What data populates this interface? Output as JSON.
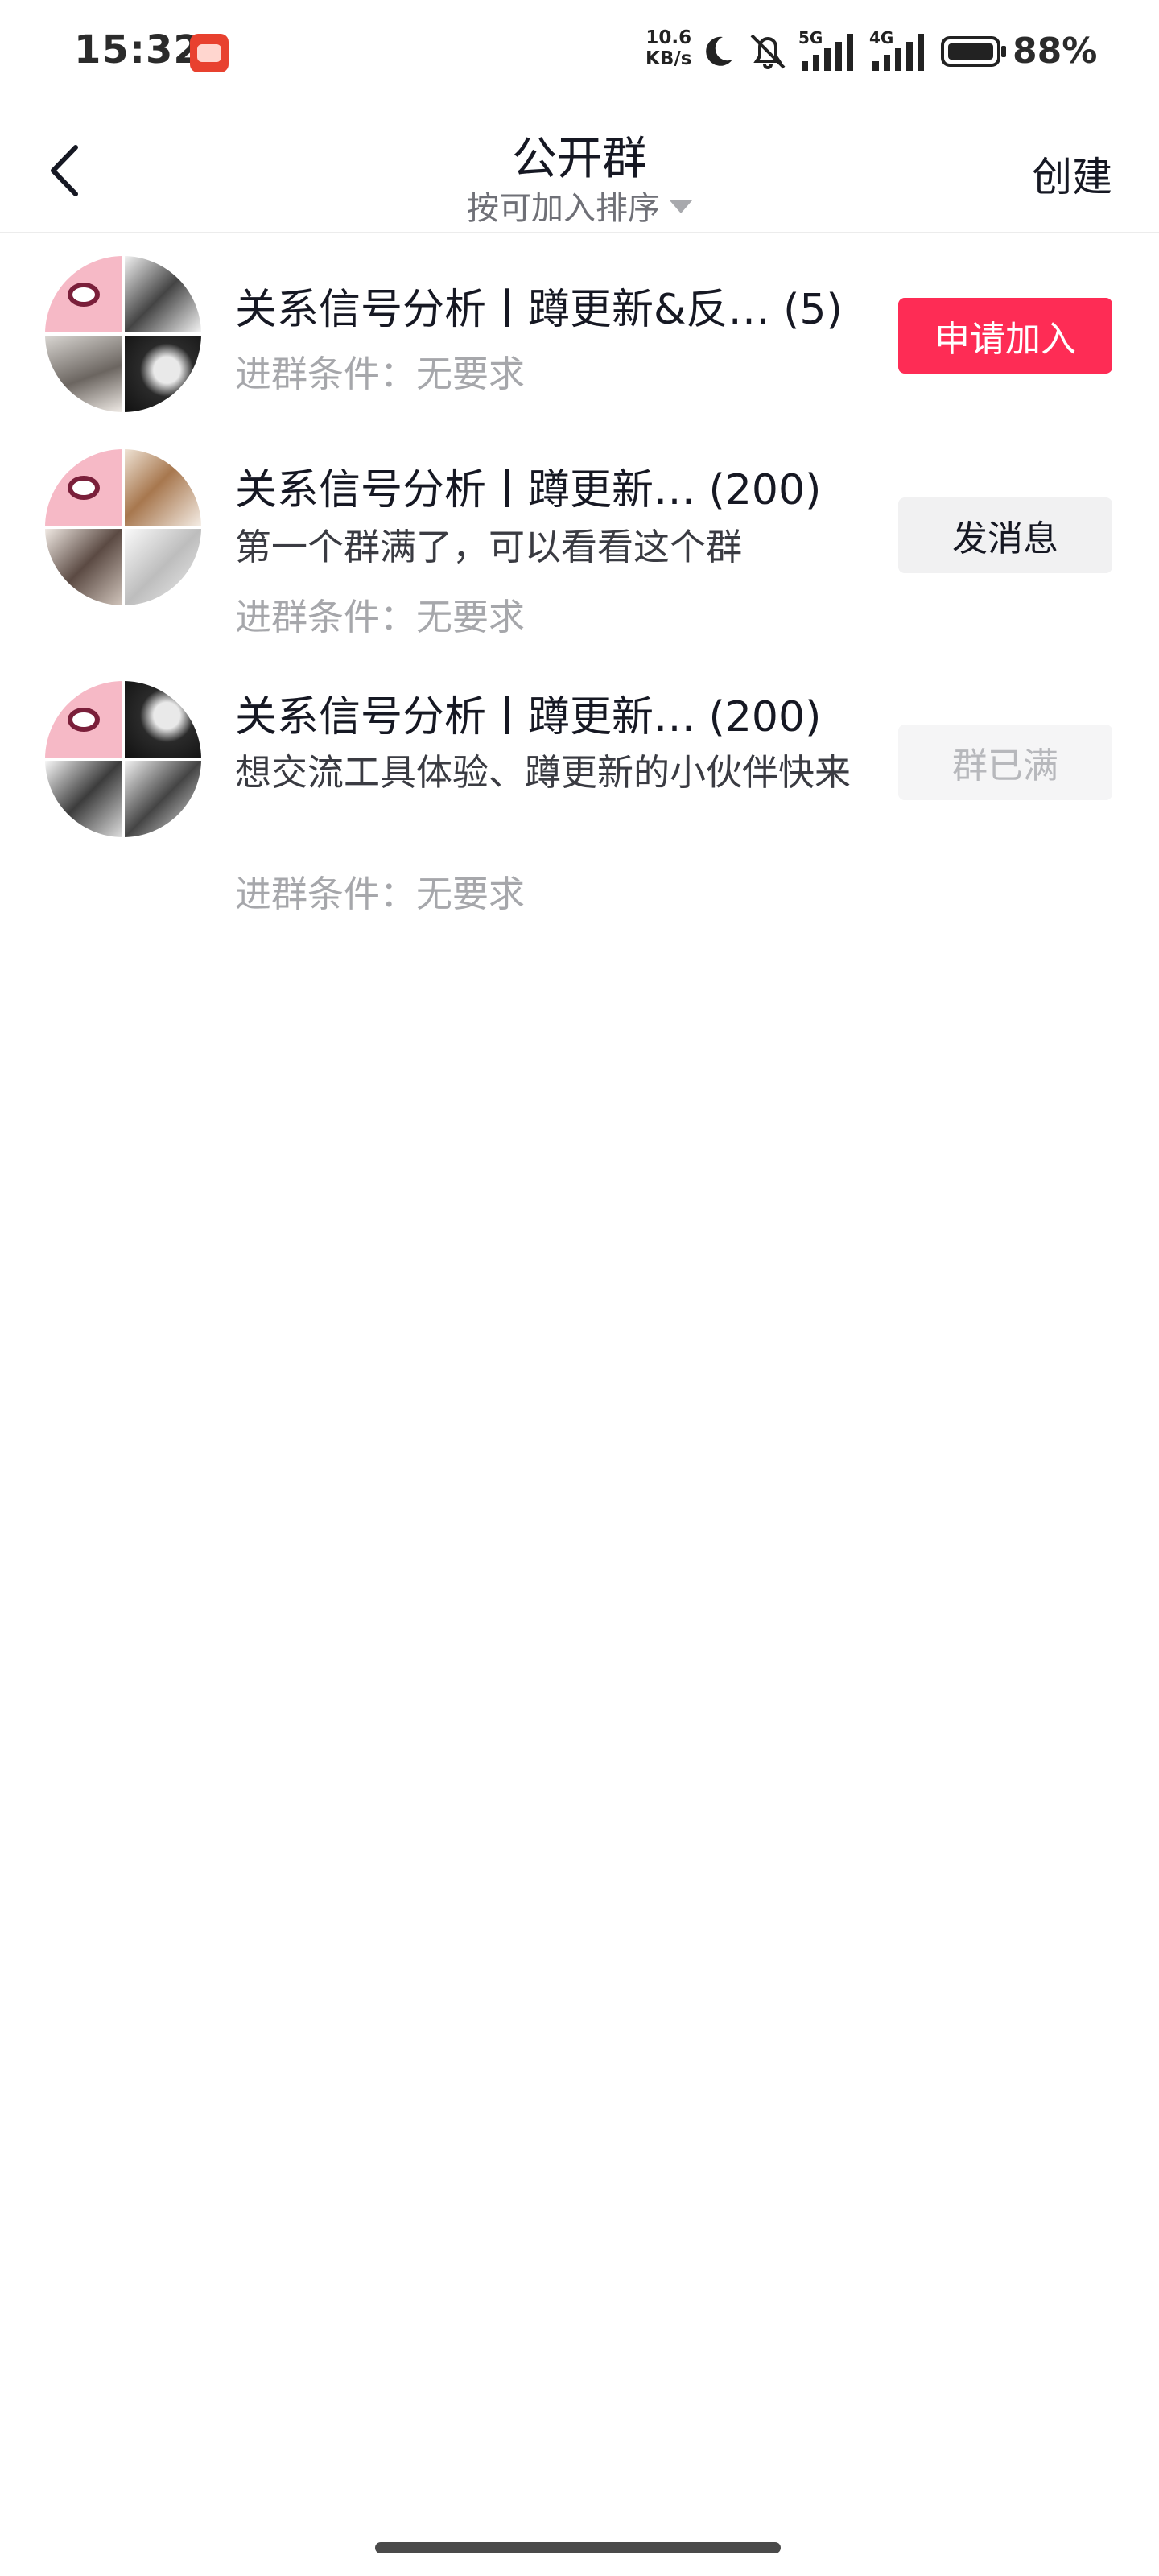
{
  "status_bar": {
    "time": "15:32",
    "net_speed_value": "10.6",
    "net_speed_unit": "KB/s",
    "network_5g": "5G",
    "network_4g": "4G",
    "battery_percent": "88%",
    "icons": [
      "app-icon",
      "moon-icon",
      "mute-bell-icon",
      "signal-5g-icon",
      "signal-4g-icon",
      "battery-icon"
    ]
  },
  "nav": {
    "title": "公开群",
    "sort_label": "按可加入排序",
    "create_label": "创建",
    "icons": [
      "back-arrow-icon",
      "sort-dropdown-icon"
    ]
  },
  "groups": [
    {
      "title": "关系信号分析丨蹲更新&反…",
      "count": "(5)",
      "description": "",
      "condition": "进群条件：无要求",
      "action_label": "申请加入",
      "action_state": "apply"
    },
    {
      "title": "关系信号分析丨蹲更新…",
      "count": "(200)",
      "description": "第一个群满了，可以看看这个群",
      "condition": "进群条件：无要求",
      "action_label": "发消息",
      "action_state": "message"
    },
    {
      "title": "关系信号分析丨蹲更新…",
      "count": "(200)",
      "description": "想交流工具体验、蹲更新的小伙伴快来",
      "condition": "进群条件：无要求",
      "action_label": "群已满",
      "action_state": "full"
    }
  ],
  "colors": {
    "accent": "#fe2c55",
    "secondary_button": "#f1f1f2",
    "muted_text": "#a6a7ab"
  }
}
